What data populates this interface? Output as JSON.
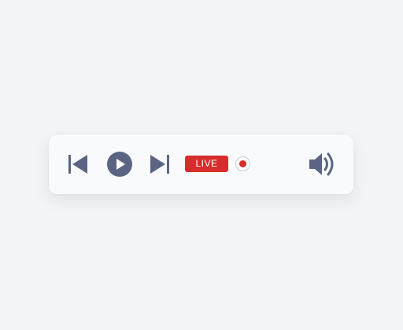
{
  "player": {
    "live_label": "LIVE",
    "icons": {
      "previous": "skip-back-icon",
      "play": "play-icon",
      "next": "skip-forward-icon",
      "record": "record-indicator-icon",
      "volume": "volume-icon"
    },
    "colors": {
      "control": "#5b6583",
      "live_badge": "#d72c2c",
      "record_dot": "#d72c2c",
      "bar_background": "#f9fafb",
      "page_background": "#f2f4f7"
    }
  }
}
